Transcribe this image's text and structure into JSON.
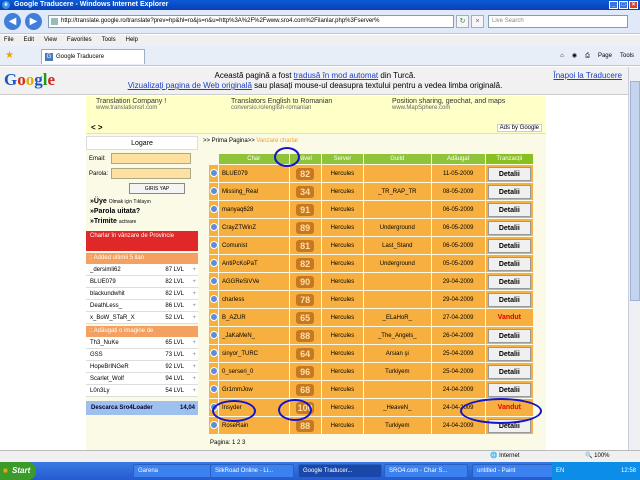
{
  "window": {
    "title": "Google Traducere - Windows Internet Explorer"
  },
  "address": {
    "url": "http://translate.google.ro/translate?prev=hp&hl=ro&js=n&u=http%3A%2F%2Fwww.sro4.com%2Filanlar.php%3Fserver%",
    "search_placeholder": "Live Search"
  },
  "menu": [
    "File",
    "Edit",
    "View",
    "Favorites",
    "Tools",
    "Help"
  ],
  "tab": {
    "label": "Google Traducere"
  },
  "toolbar": {
    "page": "Page",
    "tools": "Tools"
  },
  "google_bar": {
    "logo": [
      "G",
      "o",
      "o",
      "g",
      "l",
      "e"
    ],
    "msg_prefix": "Această pagină a fost ",
    "msg_link": "tradusă în mod automat",
    "msg_mid": " din Turcă.",
    "msg_link2": "Vizualizați pagina de Web originală",
    "msg_suffix": " sau plasați mouse-ul deasupra textului pentru a vedea limba originală.",
    "back": "Înapoi la Traducere"
  },
  "ads": [
    {
      "t1": "Translation Company !",
      "t2": "www.translationsrl.com"
    },
    {
      "t1": "Translators English to Romanian",
      "t2": "conversio.ro/english-romanian"
    },
    {
      "t1": "Position sharing, geochat, and maps",
      "t2": "www.MapSphere.com"
    }
  ],
  "ads_arrows": "< >",
  "ads_by": "Ads by Google",
  "login": {
    "title": "Logare",
    "email_label": "Email:",
    "pass_label": "Parola:",
    "button": "GIRIS YAP",
    "link1": "»Üye",
    "link1_small": "Olmak için Tıklayın",
    "link2": "»Parola uitata?",
    "link3": "»Trimite",
    "link3_small": "activare"
  },
  "sale_box": "Charlar în vânzare de Provincie",
  "added_title": ":: Added ultimii 5 ilan",
  "added": [
    {
      "name": "_dersimli62",
      "lvl": "87 LVL"
    },
    {
      "name": "BLUE079",
      "lvl": "82 LVL"
    },
    {
      "name": "blackundwhit",
      "lvl": "82 LVL"
    },
    {
      "name": "DeathLess_",
      "lvl": "86 LVL"
    },
    {
      "name": "x_BoW_STaR_X",
      "lvl": "52 LVL"
    }
  ],
  "image_title": ":: Adăugați o imagine de",
  "image_list": [
    {
      "name": "Th3_NuKe",
      "lvl": "65 LVL"
    },
    {
      "name": "GSS",
      "lvl": "73 LVL"
    },
    {
      "name": "HopeBrINGeR",
      "lvl": "92 LVL"
    },
    {
      "name": "Scarlet_Wolf",
      "lvl": "94 LVL"
    },
    {
      "name": "L0n3Ly",
      "lvl": "54 LVL"
    }
  ],
  "download": {
    "label": "Descarca Sro4Loader",
    "version": "14,04"
  },
  "breadcrumb": {
    "home": ">> Prima Pagina",
    "sep": ">> ",
    "current": "Vanzare charlar"
  },
  "table": {
    "headers": [
      "Char",
      "Nivel",
      "Server",
      "Guild",
      "Adăugat",
      "Tranzacții"
    ],
    "rows": [
      {
        "char": "BLUE079",
        "lvl": "82",
        "server": "Hercules",
        "guild": "",
        "date": "11-05-2009",
        "action": "Detalii",
        "sold": false
      },
      {
        "char": "Missing_Real",
        "lvl": "34",
        "server": "Hercules",
        "guild": "_TR_RAP_TR",
        "date": "08-05-2009",
        "action": "Detalii",
        "sold": false
      },
      {
        "char": "manyaq628",
        "lvl": "91",
        "server": "Hercules",
        "guild": "",
        "date": "06-05-2009",
        "action": "Detalii",
        "sold": false
      },
      {
        "char": "CrayZTWinZ",
        "lvl": "89",
        "server": "Hercules",
        "guild": "Underground",
        "date": "06-05-2009",
        "action": "Detalii",
        "sold": false
      },
      {
        "char": "Comunist",
        "lvl": "81",
        "server": "Hercules",
        "guild": "Last_Stand",
        "date": "06-05-2009",
        "action": "Detalii",
        "sold": false
      },
      {
        "char": "AntiPcKoPaT",
        "lvl": "82",
        "server": "Hercules",
        "guild": "Underground",
        "date": "05-05-2009",
        "action": "Detalii",
        "sold": false
      },
      {
        "char": "AGGReSiVVe",
        "lvl": "90",
        "server": "Hercules",
        "guild": "",
        "date": "29-04-2009",
        "action": "Detalii",
        "sold": false
      },
      {
        "char": "charless",
        "lvl": "78",
        "server": "Hercules",
        "guild": "",
        "date": "29-04-2009",
        "action": "Detalii",
        "sold": false
      },
      {
        "char": "B_AZUR",
        "lvl": "65",
        "server": "Hercules",
        "guild": "_ELaHoR_",
        "date": "27-04-2009",
        "action": "Vandut",
        "sold": true
      },
      {
        "char": "_JaKaMeN_",
        "lvl": "88",
        "server": "Hercules",
        "guild": "_The_Angels_",
        "date": "26-04-2009",
        "action": "Detalii",
        "sold": false
      },
      {
        "char": "sinyor_TURC",
        "lvl": "64",
        "server": "Hercules",
        "guild": "Arsian şi",
        "date": "25-04-2009",
        "action": "Detalii",
        "sold": false
      },
      {
        "char": "0_serseri_0",
        "lvl": "96",
        "server": "Hercules",
        "guild": "Turkiyem",
        "date": "25-04-2009",
        "action": "Detalii",
        "sold": false
      },
      {
        "char": "Gr1mmJow",
        "lvl": "68",
        "server": "Hercules",
        "guild": "",
        "date": "24-04-2009",
        "action": "Detalii",
        "sold": false
      },
      {
        "char": "Insyder",
        "lvl": "100",
        "server": "Hercules",
        "guild": "_HeaveN_",
        "date": "24-04-2009",
        "action": "Vandut",
        "sold": true
      },
      {
        "char": "RoseRain",
        "lvl": "88",
        "server": "Hercules",
        "guild": "Turkiyem",
        "date": "24-04-2009",
        "action": "Detalii",
        "sold": false
      }
    ]
  },
  "paging": "Pagina: 1 2 3",
  "status": {
    "zone": "Internet",
    "zoom": "100%"
  },
  "taskbar": {
    "start": "Start",
    "items": [
      "Garena",
      "SilkRoad Online - Li...",
      "Google Traducer...",
      "SRO4.com - Char S...",
      "untitled - Paint"
    ],
    "lang": "EN",
    "clock": "12:58"
  },
  "colors": {
    "accent": "#1414c8",
    "header_green": "#8fc33a",
    "row_orange": "#f7b040",
    "sold_red": "#e00000"
  }
}
